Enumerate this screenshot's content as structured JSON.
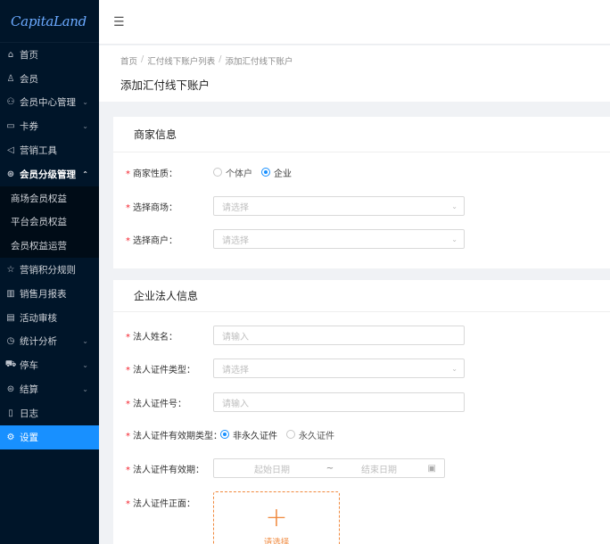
{
  "sidebar": {
    "logo": "CapitaLand",
    "items": [
      {
        "label": "首页",
        "icon": "⌂",
        "name": "home-icon"
      },
      {
        "label": "会员",
        "icon": "♙",
        "name": "user-icon"
      },
      {
        "label": "会员中心管理",
        "icon": "⚇",
        "name": "members-icon",
        "caret": "⌄"
      },
      {
        "label": "卡券",
        "icon": "▭",
        "name": "coupon-icon",
        "caret": "⌄"
      },
      {
        "label": "营销工具",
        "icon": "◁",
        "name": "marketing-icon"
      },
      {
        "label": "会员分级管理",
        "icon": "⊛",
        "name": "tier-icon",
        "caret": "⌃"
      }
    ],
    "submenu": [
      {
        "label": "商场会员权益"
      },
      {
        "label": "平台会员权益"
      },
      {
        "label": "会员权益运营"
      }
    ],
    "items2": [
      {
        "label": "营销积分规则",
        "icon": "☆",
        "name": "star-icon"
      },
      {
        "label": "销售月报表",
        "icon": "▥",
        "name": "chart-icon"
      },
      {
        "label": "活动审核",
        "icon": "▤",
        "name": "audit-icon"
      },
      {
        "label": "统计分析",
        "icon": "◷",
        "name": "stats-icon",
        "caret": "⌄"
      },
      {
        "label": "停车",
        "icon": "⛟",
        "name": "car-icon",
        "caret": "⌄"
      },
      {
        "label": "结算",
        "icon": "⊜",
        "name": "settlement-icon",
        "caret": "⌄"
      },
      {
        "label": "日志",
        "icon": "▯",
        "name": "log-icon"
      },
      {
        "label": "设置",
        "icon": "⚙",
        "name": "gear-icon"
      }
    ]
  },
  "header": {
    "breadcrumb": [
      "首页",
      "汇付线下账户列表",
      "添加汇付线下账户"
    ],
    "title": "添加汇付线下账户"
  },
  "merchant": {
    "title": "商家信息",
    "type_label": "商家性质：",
    "type_options": [
      "个体户",
      "企业"
    ],
    "mall_label": "选择商场：",
    "mall_placeholder": "请选择",
    "shop_label": "选择商户：",
    "shop_placeholder": "请选择"
  },
  "legal": {
    "title": "企业法人信息",
    "name_label": "法人姓名：",
    "name_placeholder": "请输入",
    "idtype_label": "法人证件类型：",
    "idtype_placeholder": "请选择",
    "idno_label": "法人证件号：",
    "idno_placeholder": "请输入",
    "validity_type_label": "法人证件有效期类型：",
    "validity_options": [
      "非永久证件",
      "永久证件"
    ],
    "validity_label": "法人证件有效期：",
    "start_placeholder": "起始日期",
    "tilde": "~",
    "end_placeholder": "结束日期",
    "front_label": "法人证件正面：",
    "upload_text": "请选择"
  },
  "colors": {
    "accent": "#1890ff",
    "required": "#f5222d",
    "upload": "#f0883c",
    "sidebar": "#001529"
  }
}
